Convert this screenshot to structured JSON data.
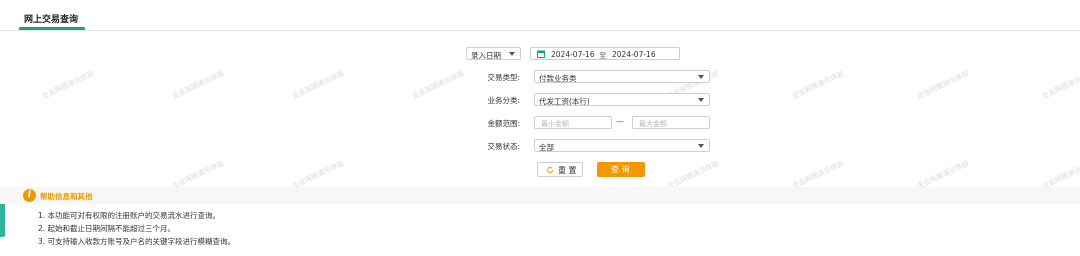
{
  "tab": {
    "title": "网上交易查询"
  },
  "watermark": "企业网银演示体验",
  "form": {
    "date_type": "录入日期",
    "date_start": "2024-07-16",
    "date_sep": "至",
    "date_end": "2024-07-16",
    "trans_type_label": "交易类型:",
    "trans_type_value": "付款业务类",
    "biz_category_label": "业务分类:",
    "biz_category_value": "代发工资(本行)",
    "amount_label": "金额范围:",
    "amount_min_placeholder": "最小金额",
    "amount_dash": "—",
    "amount_max_placeholder": "最大金额",
    "status_label": "交易状态:",
    "status_value": "全部",
    "reset_label": "重 置",
    "query_label": "查 询"
  },
  "help": {
    "title": "帮助信息和其他",
    "notes": [
      "1. 本功能可对有权限的注册账户的交易流水进行查询。",
      "2. 起始和截止日期间隔不能超过三个月。",
      "3. 可支持输入收款方账号及户名的关键字段进行模糊查询。"
    ]
  },
  "colors": {
    "accent": "#1aa37f",
    "orange": "#f39800"
  }
}
